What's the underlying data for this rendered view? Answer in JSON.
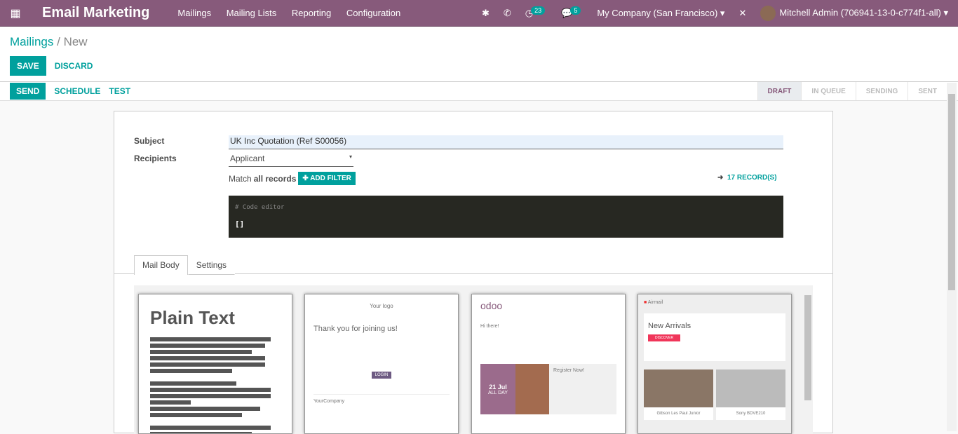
{
  "nav": {
    "app_title": "Email Marketing",
    "menu": [
      "Mailings",
      "Mailing Lists",
      "Reporting",
      "Configuration"
    ],
    "activity_count": "23",
    "message_count": "5",
    "company": "My Company (San Francisco)",
    "user": "Mitchell Admin (706941-13-0-c774f1-all)"
  },
  "breadcrumb": {
    "parent": "Mailings",
    "current": "New"
  },
  "buttons": {
    "save": "SAVE",
    "discard": "DISCARD",
    "send": "SEND",
    "schedule": "SCHEDULE",
    "test": "TEST"
  },
  "status": [
    "DRAFT",
    "IN QUEUE",
    "SENDING",
    "SENT"
  ],
  "form": {
    "subject_label": "Subject",
    "subject": "UK Inc Quotation (Ref S00056)",
    "recipients_label": "Recipients",
    "recipients": "Applicant",
    "match_prefix": "Match",
    "match_bold": "all records",
    "add_filter": "ADD FILTER",
    "records": "17 RECORD(S)",
    "code_comment": "# Code editor",
    "code_value": "[]"
  },
  "tabs": [
    "Mail Body",
    "Settings"
  ],
  "templates": {
    "plain": "Plain Text",
    "welcome_logo": "Your logo",
    "welcome_title": "Thank you for joining us!",
    "welcome_login": "LOGIN",
    "welcome_company": "YourCompany",
    "odoo_logo": "odoo",
    "odoo_greeting": "Hi there!",
    "odoo_date": "21 Jul",
    "odoo_allday": "ALL DAY",
    "odoo_register": "Register Now!",
    "airmail": "Airmail",
    "new_arrivals": "New Arrivals",
    "discover": "DISCOVER",
    "product1": "Gibson Les Paul Junior",
    "product2": "Sony BDVE210"
  }
}
